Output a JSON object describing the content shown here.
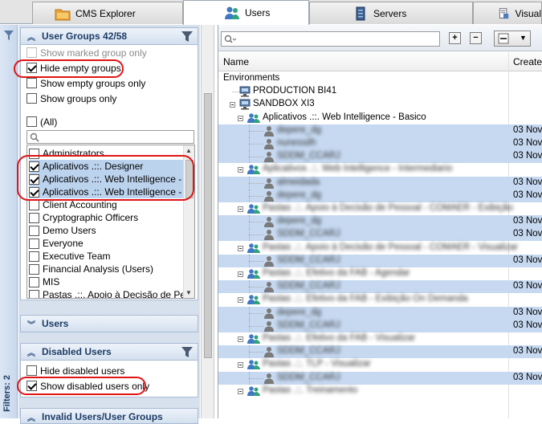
{
  "tabs": [
    {
      "label": "CMS Explorer",
      "icon": "folder-icon"
    },
    {
      "label": "Users",
      "icon": "users-icon"
    },
    {
      "label": "Servers",
      "icon": "server-icon"
    },
    {
      "label": "Visual",
      "icon": "document-icon"
    }
  ],
  "filters_strip": {
    "label": "Filters: 2"
  },
  "user_groups": {
    "title": "User Groups 42/58",
    "options": [
      {
        "label": "Show marked group only",
        "checked": false,
        "enabled": false
      },
      {
        "label": "Hide empty groups",
        "checked": true,
        "enabled": true
      },
      {
        "label": "Show empty groups only",
        "checked": false,
        "enabled": true
      },
      {
        "label": "Show groups only",
        "checked": false,
        "enabled": true
      }
    ],
    "all_label": "(All)",
    "search_placeholder": "",
    "groups": [
      {
        "label": "Administrators",
        "checked": false,
        "selected": false
      },
      {
        "label": "Aplicativos .::. Designer",
        "checked": true,
        "selected": true
      },
      {
        "label": "Aplicativos .::. Web Intelligence - B...",
        "checked": true,
        "selected": true
      },
      {
        "label": "Aplicativos .::. Web Intelligence - I...",
        "checked": true,
        "selected": true
      },
      {
        "label": "Client Accounting",
        "checked": false,
        "selected": false
      },
      {
        "label": "Cryptographic Officers",
        "checked": false,
        "selected": false
      },
      {
        "label": "Demo Users",
        "checked": false,
        "selected": false
      },
      {
        "label": "Everyone",
        "checked": false,
        "selected": false
      },
      {
        "label": "Executive Team",
        "checked": false,
        "selected": false
      },
      {
        "label": "Financial Analysis (Users)",
        "checked": false,
        "selected": false
      },
      {
        "label": "MIS",
        "checked": false,
        "selected": false
      },
      {
        "label": "Pastas .::. Apoio à Decisão de Pes...",
        "checked": false,
        "selected": false
      }
    ]
  },
  "users_section": {
    "title": "Users"
  },
  "disabled_users": {
    "title": "Disabled Users",
    "options": [
      {
        "label": "Hide disabled users",
        "checked": false
      },
      {
        "label": "Show disabled users only",
        "checked": true
      }
    ]
  },
  "invalid_section": {
    "title": "Invalid Users/User Groups"
  },
  "main": {
    "search_placeholder": "",
    "expand_label": "+",
    "collapse_label": "−",
    "columns": {
      "name": "Name",
      "created": "Created"
    },
    "rows": [
      {
        "level": 0,
        "type": "text",
        "label": "Environments",
        "created": "",
        "blur": false,
        "hl": false
      },
      {
        "level": 1,
        "type": "server",
        "label": "PRODUCTION BI41",
        "created": "",
        "blur": false,
        "hl": false
      },
      {
        "level": 1,
        "type": "server",
        "label": "SANDBOX XI3",
        "created": "",
        "blur": false,
        "hl": false,
        "node": true
      },
      {
        "level": 2,
        "type": "group",
        "label": "Aplicativos .::. Web Intelligence - Basico",
        "created": "",
        "blur": false,
        "hl": false,
        "node": true
      },
      {
        "level": 3,
        "type": "user",
        "label": "depere_dg",
        "created": "03  Nov",
        "blur": true,
        "hl": true
      },
      {
        "level": 3,
        "type": "user",
        "label": "nunessilh",
        "created": "03  Nov",
        "blur": true,
        "hl": true
      },
      {
        "level": 3,
        "type": "user",
        "label": "SDDM_CCARJ",
        "created": "03  Nov",
        "blur": true,
        "hl": true
      },
      {
        "level": 2,
        "type": "group",
        "label": "Aplicativos .::. Web Intelligence - Intermediario",
        "created": "",
        "blur": true,
        "hl": false,
        "node": true
      },
      {
        "level": 3,
        "type": "user",
        "label": "almeidada",
        "created": "03  Nov",
        "blur": true,
        "hl": true
      },
      {
        "level": 3,
        "type": "user",
        "label": "depere_dg",
        "created": "03  Nov",
        "blur": true,
        "hl": true
      },
      {
        "level": 2,
        "type": "group",
        "label": "Pastas .::. Apoio à Decisão de Pessoal - COMAER - Exibição",
        "created": "",
        "blur": true,
        "hl": false,
        "node": true
      },
      {
        "level": 3,
        "type": "user",
        "label": "depere_dg",
        "created": "03  Nov",
        "blur": true,
        "hl": true
      },
      {
        "level": 3,
        "type": "user",
        "label": "SDDM_CCARJ",
        "created": "03  Nov",
        "blur": true,
        "hl": true
      },
      {
        "level": 2,
        "type": "group",
        "label": "Pastas .::. Apoio à Decisão de Pessoal - COMAER - Visualizar",
        "created": "",
        "blur": true,
        "hl": false,
        "node": true
      },
      {
        "level": 3,
        "type": "user",
        "label": "SDDM_CCARJ",
        "created": "03  Nov",
        "blur": true,
        "hl": true
      },
      {
        "level": 2,
        "type": "group",
        "label": "Pastas .::. Efetivo da FAB - Agendar",
        "created": "",
        "blur": true,
        "hl": false,
        "node": true
      },
      {
        "level": 3,
        "type": "user",
        "label": "SDDM_CCARJ",
        "created": "03  Nov",
        "blur": true,
        "hl": true
      },
      {
        "level": 2,
        "type": "group",
        "label": "Pastas .::. Efetivo da FAB - Exibição On Demanda",
        "created": "",
        "blur": true,
        "hl": false,
        "node": true
      },
      {
        "level": 3,
        "type": "user",
        "label": "depere_dg",
        "created": "03  Nov",
        "blur": true,
        "hl": true
      },
      {
        "level": 3,
        "type": "user",
        "label": "SDDM_CCARJ",
        "created": "03  Nov",
        "blur": true,
        "hl": true
      },
      {
        "level": 2,
        "type": "group",
        "label": "Pastas .::. Efetivo da FAB - Visualizar",
        "created": "",
        "blur": true,
        "hl": false,
        "node": true
      },
      {
        "level": 3,
        "type": "user",
        "label": "SDDM_CCARJ",
        "created": "03  Nov",
        "blur": true,
        "hl": true
      },
      {
        "level": 2,
        "type": "group",
        "label": "Pastas .::. TLP - Visualizar",
        "created": "",
        "blur": true,
        "hl": false,
        "node": true
      },
      {
        "level": 3,
        "type": "user",
        "label": "SDDM_CCARJ",
        "created": "03  Nov",
        "blur": true,
        "hl": true
      },
      {
        "level": 2,
        "type": "group",
        "label": "Pastas .::. Treinamento",
        "created": "",
        "blur": true,
        "hl": false,
        "node": true
      }
    ]
  },
  "colors": {
    "accent": "#1d3c66",
    "highlight": "#c6d9f1",
    "annotation": "#e01414"
  }
}
